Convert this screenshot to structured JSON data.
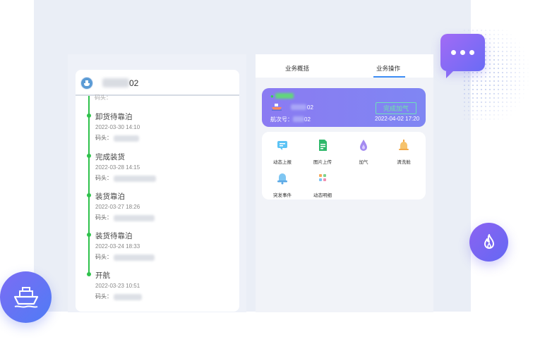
{
  "timeline": {
    "vessel_name_suffix": "02",
    "peek_label": "码头：",
    "events": [
      {
        "title": "卸货待靠泊",
        "time": "2022-03-30 14:10",
        "dock_label": "码头："
      },
      {
        "title": "完成装货",
        "time": "2022-03-28 14:15",
        "dock_label": "码头："
      },
      {
        "title": "装货靠泊",
        "time": "2022-03-27 18:26",
        "dock_label": "码头："
      },
      {
        "title": "装货待靠泊",
        "time": "2022-03-24 18:33",
        "dock_label": "码头："
      },
      {
        "title": "开航",
        "time": "2022-03-23 10:51",
        "dock_label": "码头："
      }
    ]
  },
  "tabs": [
    {
      "label": "业务概括"
    },
    {
      "label": "业务操作"
    }
  ],
  "ship_card": {
    "name_suffix": "02",
    "voyage_label": "航次号：",
    "voyage_suffix": "02",
    "action_label": "完成加气",
    "time": "2022-04-02 17:20"
  },
  "operations": [
    {
      "label": "动态上报",
      "icon": "report-icon"
    },
    {
      "label": "图片上传",
      "icon": "image-upload-icon"
    },
    {
      "label": "加气",
      "icon": "gas-drop-icon"
    },
    {
      "label": "清洗舱",
      "icon": "tank-clean-icon"
    },
    {
      "label": "突发事件",
      "icon": "alarm-bell-icon"
    },
    {
      "label": "动态明细",
      "icon": "detail-list-icon"
    }
  ],
  "colors": {
    "accent": "#7f86f3",
    "timeline_green": "#2fc24c",
    "tab_active": "#3c8cf5"
  }
}
